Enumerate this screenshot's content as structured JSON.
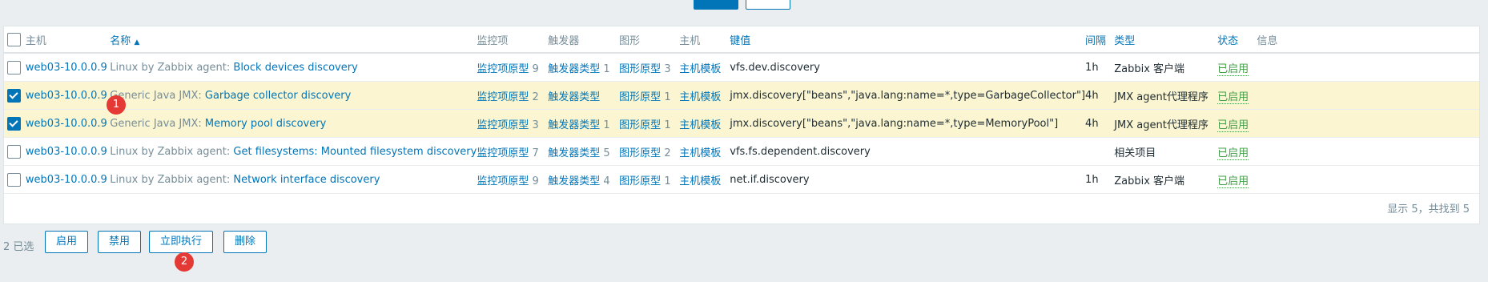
{
  "header": {
    "select_all": false,
    "col_host": "主机",
    "col_name": "名称",
    "col_items": "监控项",
    "col_triggers": "触发器",
    "col_graphs": "图形",
    "col_hosts": "主机",
    "col_key": "键值",
    "col_interval": "间隔",
    "col_type": "类型",
    "col_status": "状态",
    "col_info": "信息"
  },
  "rows": [
    {
      "checked": false,
      "host": "web03-10.0.0.9",
      "template": "Linux by Zabbix agent",
      "name": "Block devices discovery",
      "items_label": "监控项原型",
      "items_count": "9",
      "triggers_label": "触发器类型",
      "triggers_count": "1",
      "graphs_label": "图形原型",
      "graphs_count": "3",
      "hosts_label": "主机模板",
      "key": "vfs.dev.discovery",
      "interval": "1h",
      "type": "Zabbix 客户端",
      "status": "已启用"
    },
    {
      "checked": true,
      "host": "web03-10.0.0.9",
      "template": "Generic Java JMX",
      "name": "Garbage collector discovery",
      "items_label": "监控项原型",
      "items_count": "2",
      "triggers_label": "触发器类型",
      "triggers_count": "",
      "graphs_label": "图形原型",
      "graphs_count": "1",
      "hosts_label": "主机模板",
      "key": "jmx.discovery[\"beans\",\"java.lang:name=*,type=GarbageCollector\"]",
      "interval": "4h",
      "type": "JMX agent代理程序",
      "status": "已启用"
    },
    {
      "checked": true,
      "host": "web03-10.0.0.9",
      "template": "Generic Java JMX",
      "name": "Memory pool discovery",
      "items_label": "监控项原型",
      "items_count": "3",
      "triggers_label": "触发器类型",
      "triggers_count": "1",
      "graphs_label": "图形原型",
      "graphs_count": "1",
      "hosts_label": "主机模板",
      "key": "jmx.discovery[\"beans\",\"java.lang:name=*,type=MemoryPool\"]",
      "interval": "4h",
      "type": "JMX agent代理程序",
      "status": "已启用"
    },
    {
      "checked": false,
      "host": "web03-10.0.0.9",
      "template": "Linux by Zabbix agent",
      "name": "Get filesystems: Mounted filesystem discovery",
      "items_label": "监控项原型",
      "items_count": "7",
      "triggers_label": "触发器类型",
      "triggers_count": "5",
      "graphs_label": "图形原型",
      "graphs_count": "2",
      "hosts_label": "主机模板",
      "key": "vfs.fs.dependent.discovery",
      "interval": "",
      "type": "相关项目",
      "status": "已启用"
    },
    {
      "checked": false,
      "host": "web03-10.0.0.9",
      "template": "Linux by Zabbix agent",
      "name": "Network interface discovery",
      "items_label": "监控项原型",
      "items_count": "9",
      "triggers_label": "触发器类型",
      "triggers_count": "4",
      "graphs_label": "图形原型",
      "graphs_count": "1",
      "hosts_label": "主机模板",
      "key": "net.if.discovery",
      "interval": "1h",
      "type": "Zabbix 客户端",
      "status": "已启用"
    }
  ],
  "summary": "显示 5，共找到 5",
  "bottom": {
    "selected_count": "2 已选",
    "enable": "启用",
    "disable": "禁用",
    "execute_now": "立即执行",
    "delete": "删除"
  },
  "badges": {
    "b1": "1",
    "b2": "2"
  },
  "colors": {
    "link": "#0275b8",
    "enabled": "#429e47",
    "selected_row": "#fbf6d1",
    "badge": "#e53935"
  }
}
